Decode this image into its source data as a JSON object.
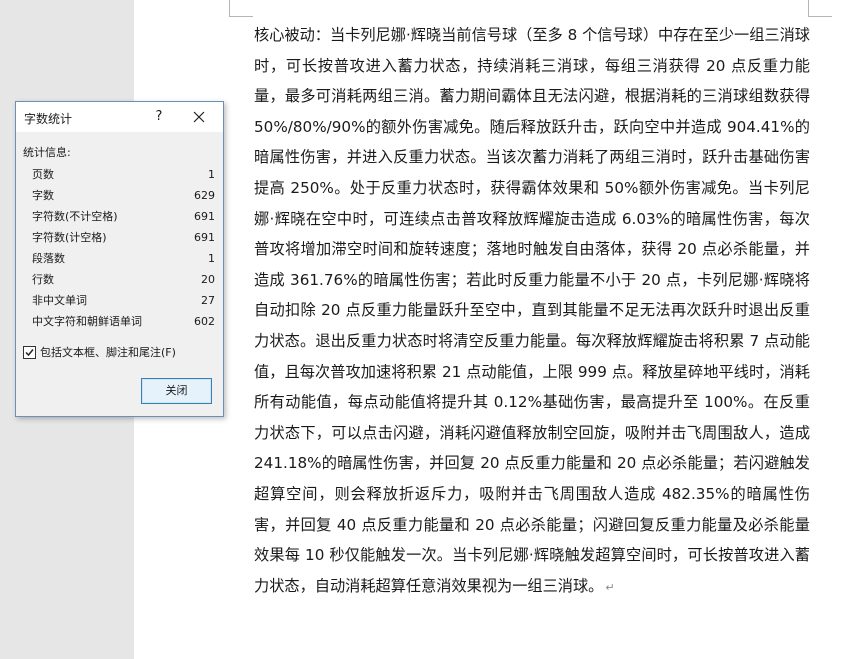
{
  "document": {
    "paragraph": "核心被动：当卡列尼娜·辉晓当前信号球（至多 8 个信号球）中存在至少一组三消球时，可长按普攻进入蓄力状态，持续消耗三消球，每组三消获得 20 点反重力能量，最多可消耗两组三消。蓄力期间霸体且无法闪避，根据消耗的三消球组数获得 50%/80%/90%的额外伤害减免。随后释放跃升击，跃向空中并造成 904.41%的暗属性伤害，并进入反重力状态。当该次蓄力消耗了两组三消时，跃升击基础伤害提高 250%。处于反重力状态时，获得霸体效果和 50%额外伤害减免。当卡列尼娜·辉晓在空中时，可连续点击普攻释放辉耀旋击造成 6.03%的暗属性伤害，每次普攻将增加滞空时间和旋转速度；落地时触发自由落体，获得 20 点必杀能量，并造成 361.76%的暗属性伤害；若此时反重力能量不小于 20 点，卡列尼娜·辉晓将自动扣除 20 点反重力能量跃升至空中，直到其能量不足无法再次跃升时退出反重力状态。退出反重力状态时将清空反重力能量。每次释放辉耀旋击将积累 7 点动能值，且每次普攻加速将积累 21 点动能值，上限 999 点。释放星碎地平线时，消耗所有动能值，每点动能值将提升其 0.12%基础伤害，最高提升至 100%。在反重力状态下，可以点击闪避，消耗闪避值释放制空回旋，吸附并击飞周围敌人，造成 241.18%的暗属性伤害，并回复 20 点反重力能量和 20 点必杀能量；若闪避触发超算空间，则会释放折返斥力，吸附并击飞周围敌人造成 482.35%的暗属性伤害，并回复 40 点反重力能量和 20 点必杀能量；闪避回复反重力能量及必杀能量效果每 10 秒仅能触发一次。当卡列尼娜·辉晓触发超算空间时，可长按普攻进入蓄力状态，自动消耗超算任意消效果视为一组三消球。",
    "paragraph_mark": "↵"
  },
  "dialog": {
    "title": "字数统计",
    "help_label": "?",
    "section_label": "统计信息:",
    "stats": [
      {
        "label": "页数",
        "value": "1"
      },
      {
        "label": "字数",
        "value": "629"
      },
      {
        "label": "字符数(不计空格)",
        "value": "691"
      },
      {
        "label": "字符数(计空格)",
        "value": "691"
      },
      {
        "label": "段落数",
        "value": "1"
      },
      {
        "label": "行数",
        "value": "20"
      },
      {
        "label": "非中文单词",
        "value": "27"
      },
      {
        "label": "中文字符和朝鲜语单词",
        "value": "602"
      }
    ],
    "checkbox_label": "包括文本框、脚注和尾注(F)",
    "checkbox_checked": true,
    "close_button_label": "关闭"
  },
  "icons": {
    "close": "close-icon",
    "check": "checkmark-icon"
  }
}
